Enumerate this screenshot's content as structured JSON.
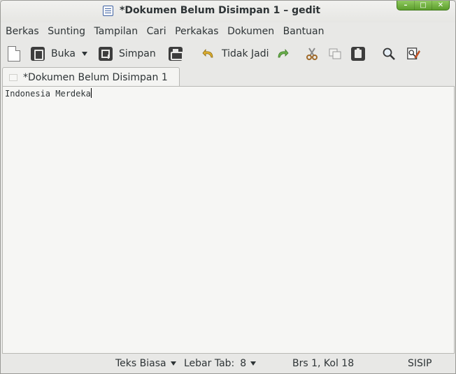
{
  "window": {
    "title": "*Dokumen Belum Disimpan 1 – gedit",
    "controls": [
      "minimize",
      "maximize",
      "close"
    ]
  },
  "menubar": {
    "items": [
      "Berkas",
      "Sunting",
      "Tampilan",
      "Cari",
      "Perkakas",
      "Dokumen",
      "Bantuan"
    ]
  },
  "toolbar": {
    "open_label": "Buka",
    "save_label": "Simpan",
    "undo_label": "Tidak Jadi"
  },
  "tab": {
    "label": "*Dokumen Belum Disimpan 1"
  },
  "editor": {
    "content": "Indonesia Merdeka"
  },
  "statusbar": {
    "language": "Teks Biasa",
    "tab_width_label": "Lebar Tab:",
    "tab_width_value": "8",
    "position": "Brs 1, Kol 18",
    "mode": "SISIP"
  },
  "icons": {
    "new": "new-document-icon",
    "open": "open-icon",
    "save": "save-icon",
    "print": "print-icon",
    "undo": "undo-icon",
    "redo": "redo-icon",
    "cut": "cut-icon",
    "copy": "copy-icon",
    "paste": "paste-icon",
    "find": "search-icon",
    "replace": "find-replace-icon"
  },
  "colors": {
    "titlebar_buttons": "#6aab3a",
    "undo_icon": "#e0b030",
    "redo_icon": "#6ab04c"
  }
}
